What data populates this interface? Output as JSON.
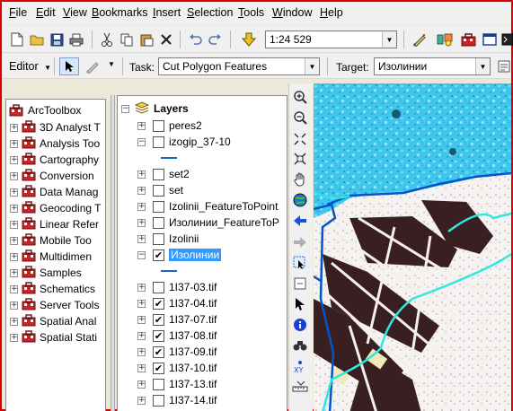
{
  "menu": [
    "File",
    "Edit",
    "View",
    "Bookmarks",
    "Insert",
    "Selection",
    "Tools",
    "Window",
    "Help"
  ],
  "menu_accel": [
    "F",
    "E",
    "V",
    "B",
    "I",
    "S",
    "T",
    "W",
    "H"
  ],
  "scale": "1:24 529",
  "editor": {
    "label": "Editor",
    "task_label": "Task:",
    "task_value": "Cut Polygon Features",
    "target_label": "Target:",
    "target_value": "Изолинии"
  },
  "toolbox": {
    "root": "ArcToolbox",
    "items": [
      "3D Analyst T",
      "Analysis Too",
      "Cartography",
      "Conversion",
      "Data Manag",
      "Geocoding T",
      "Linear Refer",
      "Mobile Too",
      "Multidimen",
      "Samples",
      "Schematics",
      "Server Tools",
      "Spatial Anal",
      "Spatial Stati"
    ]
  },
  "layers": {
    "root": "Layers",
    "items": [
      {
        "name": "peres2",
        "checked": false,
        "expanded": false
      },
      {
        "name": "izogip_37-10",
        "checked": false,
        "expanded": true
      },
      {
        "name": "set2",
        "checked": false,
        "expanded": false
      },
      {
        "name": "set",
        "checked": false,
        "expanded": false
      },
      {
        "name": "Izolinii_FeatureToPoint",
        "checked": false,
        "expanded": false
      },
      {
        "name": "Изолинии_FeatureToP",
        "checked": false,
        "expanded": false
      },
      {
        "name": "Izolinii",
        "checked": false,
        "expanded": false
      },
      {
        "name": "Изолинии",
        "checked": true,
        "expanded": true,
        "selected": true
      },
      {
        "name": "1I37-03.tif",
        "checked": false,
        "expanded": false
      },
      {
        "name": "1I37-04.tif",
        "checked": true,
        "expanded": false
      },
      {
        "name": "1I37-07.tif",
        "checked": true,
        "expanded": false
      },
      {
        "name": "1I37-08.tif",
        "checked": true,
        "expanded": false
      },
      {
        "name": "1I37-09.tif",
        "checked": true,
        "expanded": false
      },
      {
        "name": "1I37-10.tif",
        "checked": true,
        "expanded": false
      },
      {
        "name": "1I37-13.tif",
        "checked": false,
        "expanded": false
      },
      {
        "name": "1I37-14.tif",
        "checked": false,
        "expanded": false
      }
    ]
  },
  "icons": {
    "tools": [
      "zoom-in-icon",
      "zoom-out-icon",
      "fixed-zoom-in-icon",
      "fixed-zoom-out-icon",
      "pan-icon",
      "full-extent-icon",
      "back-extent-icon",
      "forward-extent-icon",
      "select-features-icon",
      "clear-selection-icon",
      "select-elements-icon",
      "identify-icon",
      "find-icon",
      "goto-xy-icon",
      "measure-icon"
    ]
  },
  "colors": {
    "selection": "#3399ff",
    "line_symbol": "#1a64c8",
    "contour": "#2ee8e0",
    "boundary": "#0055cc",
    "frame": "#dd0000"
  }
}
